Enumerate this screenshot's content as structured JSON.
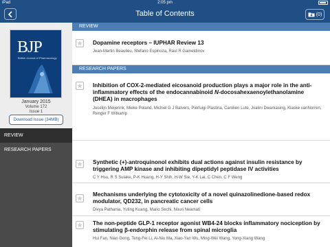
{
  "status_bar": {
    "carrier": "iPad",
    "time": "2:05 pm"
  },
  "nav": {
    "title": "Table of Contents",
    "downloads_count": "(0)"
  },
  "issue": {
    "journal_logo": "BJP",
    "journal_name": "British Journal of Pharmacology",
    "date": "January 2015",
    "volume": "Volume 172",
    "issue": "Issue 1",
    "download_label": "Download Issue (34MB)"
  },
  "sidebar": {
    "items": [
      {
        "label": "REVIEW"
      },
      {
        "label": "RESEARCH PAPERS"
      }
    ]
  },
  "sections": [
    {
      "header": "REVIEW",
      "articles": [
        {
          "title": "Dopamine receptors – IUPHAR Review 13",
          "authors": "Jean-Martin Beaulieu, Stefano Espinoza, Raul R Gainetdinov"
        }
      ]
    },
    {
      "header": "RESEARCH PAPERS",
      "articles": [
        {
          "title_a": "Inhibition of COX-2-mediated eicosanoid production plays a major role in the anti-inflammatory effects of the endocannabinoid ",
          "title_b": "N",
          "title_c": "-docosahexaenoylethanolamine (DHEA) in macrophages",
          "authors": "Jocelijn Meijerink, Mieke Poland, Michiel G J Balvers, Pierluigi Plastina, Carolien Lute, Jvalini Dwarkasing, Klaske vanNorren, Renger F Witkamp"
        },
        {
          "title": "Synthetic (+)-antroquinonol exhibits dual actions against insulin resistance by triggering AMP kinase and inhibiting dipeptidyl peptidase IV activities",
          "authors": "C Y Hsu, R S Sulake, P-K Huang, H-Y Shih, H-W Sie, Y-K Lai, C Chen, C F Weng"
        },
        {
          "title": "Mechanisms underlying the cytotoxicity of a novel quinazolinedione-based redox modulator, QD232, in pancreatic cancer cells",
          "authors": "Divya Pathania, Yuting Kuang, Mario Sechi, Nouri Neamati"
        },
        {
          "title": "The non-peptide GLP-1 receptor agonist WB4-24 blocks inflammatory nociception by stimulating β-endorphin release from spinal microglia",
          "authors": "Hui Fan, Nian Gong, Teng-Fei Li, Ai-Niu Ma, Xiao-Yan Wu, Ming-Wei Wang, Yong-Xiang Wang"
        }
      ]
    }
  ],
  "colors": {
    "nav": "#1f4f84",
    "section_header": "#4c7db3",
    "sidebar": "#4a4a4a"
  },
  "icons": [
    "back-arrow-icon",
    "download-folder-icon",
    "star-icon",
    "wifi-icon",
    "battery-icon"
  ]
}
